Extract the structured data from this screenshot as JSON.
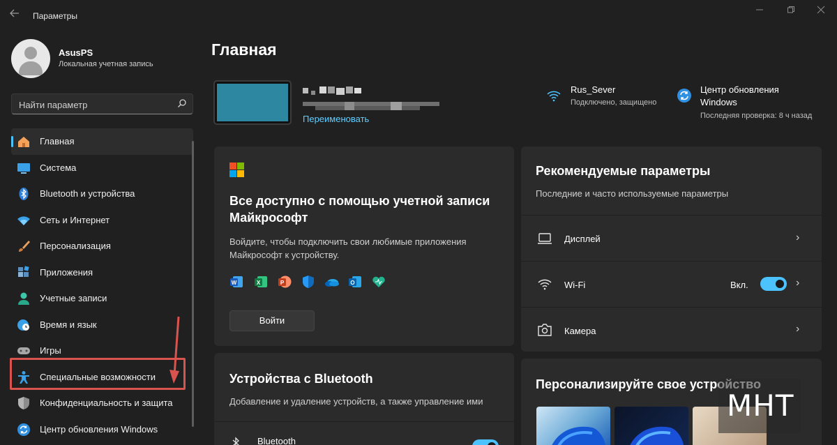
{
  "window": {
    "title": "Параметры"
  },
  "user": {
    "name": "AsusPS",
    "account_type": "Локальная учетная запись"
  },
  "search": {
    "placeholder": "Найти параметр"
  },
  "sidebar": {
    "items": [
      {
        "label": "Главная",
        "icon": "home-icon",
        "active": true
      },
      {
        "label": "Система",
        "icon": "monitor-icon"
      },
      {
        "label": "Bluetooth и устройства",
        "icon": "bluetooth-icon"
      },
      {
        "label": "Сеть и Интернет",
        "icon": "wifi-icon"
      },
      {
        "label": "Персонализация",
        "icon": "brush-icon"
      },
      {
        "label": "Приложения",
        "icon": "apps-icon"
      },
      {
        "label": "Учетные записи",
        "icon": "person-icon"
      },
      {
        "label": "Время и язык",
        "icon": "clock-globe-icon"
      },
      {
        "label": "Игры",
        "icon": "gamepad-icon"
      },
      {
        "label": "Специальные возможности",
        "icon": "accessibility-icon"
      },
      {
        "label": "Конфиденциальность и защита",
        "icon": "shield-icon"
      },
      {
        "label": "Центр обновления Windows",
        "icon": "update-icon"
      }
    ]
  },
  "main": {
    "title": "Главная",
    "device": {
      "rename_label": "Переименовать"
    },
    "wifi_status": {
      "network": "Rus_Sever",
      "status": "Подключено, защищено"
    },
    "update_status": {
      "title_line1": "Центр обновления",
      "title_line2": "Windows",
      "last_check": "Последняя проверка: 8 ч назад"
    },
    "ms_account_card": {
      "title_line1": "Все доступно с помощью учетной записи",
      "title_line2": "Майкрософт",
      "text_line1": "Войдите, чтобы подключить свои любимые приложения",
      "text_line2": "Майкрософт к устройству.",
      "button": "Войти",
      "apps": [
        "word-icon",
        "excel-icon",
        "powerpoint-icon",
        "defender-icon",
        "onedrive-icon",
        "outlook-icon",
        "family-icon"
      ]
    },
    "recommended": {
      "title": "Рекомендуемые параметры",
      "subtitle": "Последние и часто используемые параметры",
      "rows": [
        {
          "label": "Дисплей",
          "icon": "laptop-icon"
        },
        {
          "label": "Wi-Fi",
          "icon": "wifi-icon",
          "toggle_label": "Вкл.",
          "toggle_on": true
        },
        {
          "label": "Камера",
          "icon": "camera-icon"
        }
      ]
    },
    "bluetooth_card": {
      "title": "Устройства с Bluetooth",
      "subtitle": "Добавление и удаление устройств, а также управление ими",
      "row_label": "Bluetooth"
    },
    "personalize_card": {
      "title": "Персонализируйте свое устройство"
    }
  },
  "watermark": {
    "text": "MHT"
  },
  "colors": {
    "accent": "#4cc2ff",
    "link": "#60cdff",
    "highlight": "#d9534f"
  }
}
